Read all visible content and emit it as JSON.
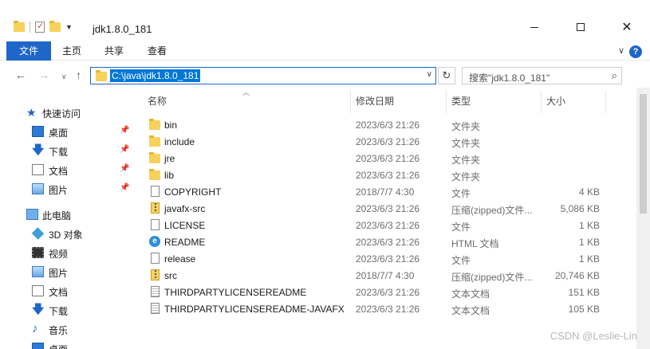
{
  "window": {
    "title": "jdk1.8.0_181",
    "minimize": "",
    "maximize": "",
    "close": "✕"
  },
  "ribbon": {
    "tabs": [
      "文件",
      "主页",
      "共享",
      "查看"
    ],
    "help": "?"
  },
  "address": {
    "path": "C:\\java\\jdk1.8.0_181",
    "search_placeholder": "搜索\"jdk1.8.0_181\""
  },
  "columns": {
    "name": "名称",
    "date": "修改日期",
    "type": "类型",
    "size": "大小"
  },
  "nav": {
    "quick_access": "快速访问",
    "quick_items": [
      "桌面",
      "下载",
      "文档",
      "图片"
    ],
    "this_pc": "此电脑",
    "pc_items": [
      "3D 对象",
      "视频",
      "图片",
      "文档",
      "下载",
      "音乐",
      "桌面"
    ]
  },
  "files": [
    {
      "name": "bin",
      "date": "2023/6/3 21:26",
      "type": "文件夹",
      "size": "",
      "icon": "folder"
    },
    {
      "name": "include",
      "date": "2023/6/3 21:26",
      "type": "文件夹",
      "size": "",
      "icon": "folder"
    },
    {
      "name": "jre",
      "date": "2023/6/3 21:26",
      "type": "文件夹",
      "size": "",
      "icon": "folder"
    },
    {
      "name": "lib",
      "date": "2023/6/3 21:26",
      "type": "文件夹",
      "size": "",
      "icon": "folder"
    },
    {
      "name": "COPYRIGHT",
      "date": "2018/7/7 4:30",
      "type": "文件",
      "size": "4 KB",
      "icon": "file"
    },
    {
      "name": "javafx-src",
      "date": "2023/6/3 21:26",
      "type": "压缩(zipped)文件...",
      "size": "5,086 KB",
      "icon": "zip"
    },
    {
      "name": "LICENSE",
      "date": "2023/6/3 21:26",
      "type": "文件",
      "size": "1 KB",
      "icon": "file"
    },
    {
      "name": "README",
      "date": "2023/6/3 21:26",
      "type": "HTML 文档",
      "size": "1 KB",
      "icon": "html"
    },
    {
      "name": "release",
      "date": "2023/6/3 21:26",
      "type": "文件",
      "size": "1 KB",
      "icon": "file"
    },
    {
      "name": "src",
      "date": "2018/7/7 4:30",
      "type": "压缩(zipped)文件...",
      "size": "20,746 KB",
      "icon": "zip"
    },
    {
      "name": "THIRDPARTYLICENSEREADME",
      "date": "2023/6/3 21:26",
      "type": "文本文档",
      "size": "151 KB",
      "icon": "txt"
    },
    {
      "name": "THIRDPARTYLICENSEREADME-JAVAFX",
      "date": "2023/6/3 21:26",
      "type": "文本文档",
      "size": "105 KB",
      "icon": "txt"
    }
  ],
  "watermark": "CSDN @Leslie-Lin"
}
